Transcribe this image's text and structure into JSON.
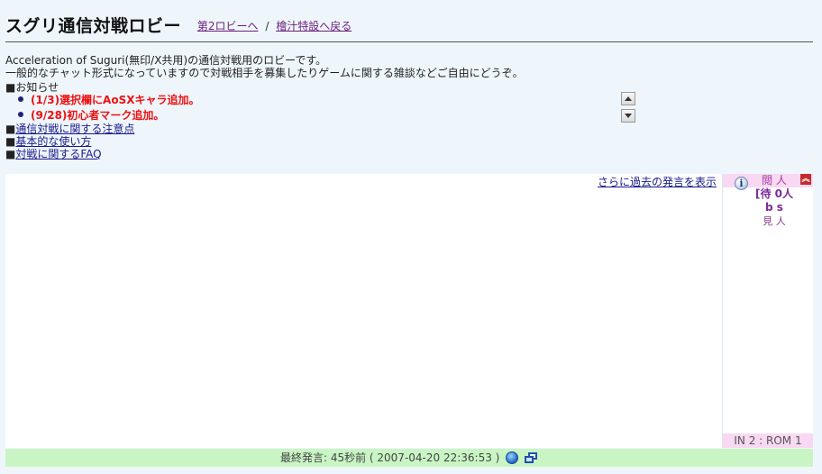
{
  "header": {
    "title": "スグリ通信対戦ロビー",
    "links": [
      {
        "label": "第2ロビーへ"
      },
      {
        "label": "檜汁特設へ戻る"
      }
    ],
    "separator": "/"
  },
  "intro": {
    "line1": "Acceleration of Suguri(無印/X共用)の通信対戦用のロビーです。",
    "line2": "一般的なチャット形式になっていますので対戦相手を募集したりゲームに関する雑談などご自由にどうぞ。"
  },
  "news": {
    "heading": "■お知らせ",
    "items": [
      "(1/3)選択欄にAoSXキャラ追加。",
      "(9/28)初心者マーク追加。"
    ]
  },
  "links": [
    {
      "prefix": "■",
      "label": "通信対戦に関する注意点"
    },
    {
      "prefix": "■",
      "label": "基本的な使い方"
    },
    {
      "prefix": "■",
      "label": "対戦に関するFAQ"
    }
  ],
  "chat": {
    "more_label": "さらに過去の発言を表示"
  },
  "sidebar": {
    "rooms": [
      "閲 人",
      "[待 0人",
      "b s",
      "見 人"
    ],
    "counts": "IN 2 : ROM 1",
    "icons": {
      "info": "info-icon",
      "collapse": "collapse-up-icon"
    }
  },
  "footer": {
    "status": "最終発言: 45秒前 ( 2007-04-20 22:36:53 )",
    "icons": [
      "globe-icon",
      "popout-window-icon"
    ]
  },
  "colors": {
    "background": "#eef6fb",
    "news_red": "#e11111",
    "footer_green": "#c9f5c4",
    "side_pink": "#f8d8f2"
  }
}
